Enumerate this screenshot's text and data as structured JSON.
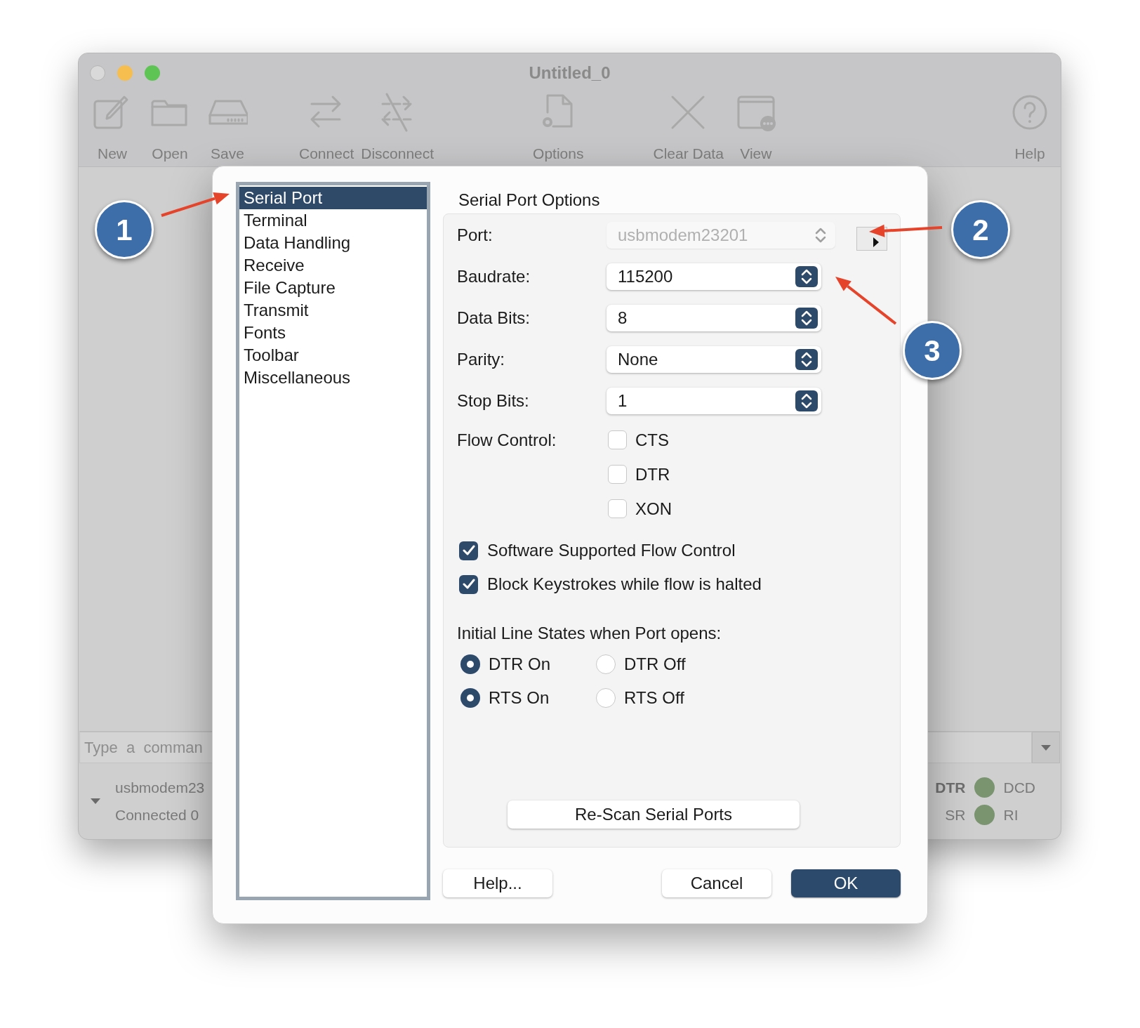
{
  "window": {
    "title": "Untitled_0"
  },
  "toolbar": {
    "groups": [
      [
        "New",
        "Open",
        "Save"
      ],
      [
        "Connect",
        "Disconnect"
      ],
      [
        "Options"
      ],
      [
        "Clear Data",
        "View"
      ]
    ],
    "help": "Help"
  },
  "command_field": {
    "placeholder": "Type  a  comman"
  },
  "status": {
    "port": "usbmodem23",
    "connection": "Connected 0",
    "left_signals": [
      {
        "label": "DTR",
        "active": true
      },
      {
        "label": "SR",
        "active": false
      }
    ],
    "right_signals": [
      "DCD",
      "RI"
    ]
  },
  "dialog": {
    "sidebar": [
      {
        "label": "Serial Port",
        "selected": true
      },
      {
        "label": "Terminal",
        "selected": false
      },
      {
        "label": "Data Handling",
        "selected": false
      },
      {
        "label": "Receive",
        "selected": false
      },
      {
        "label": "File Capture",
        "selected": false
      },
      {
        "label": "Transmit",
        "selected": false
      },
      {
        "label": "Fonts",
        "selected": false
      },
      {
        "label": "Toolbar",
        "selected": false
      },
      {
        "label": "Miscellaneous",
        "selected": false
      }
    ],
    "title": "Serial Port Options",
    "fields": [
      {
        "label": "Port:",
        "value": "usbmodem23201",
        "kind": "port",
        "disabled": true
      },
      {
        "label": "Baudrate:",
        "value": "115200",
        "kind": "popup",
        "disabled": false
      },
      {
        "label": "Data Bits:",
        "value": "8",
        "kind": "popup",
        "disabled": false
      },
      {
        "label": "Parity:",
        "value": "None",
        "kind": "popup",
        "disabled": false
      },
      {
        "label": "Stop Bits:",
        "value": "1",
        "kind": "popup",
        "disabled": false
      }
    ],
    "flow_control": {
      "label": "Flow Control:",
      "options": [
        {
          "label": "CTS",
          "checked": false
        },
        {
          "label": "DTR",
          "checked": false
        },
        {
          "label": "XON",
          "checked": false
        }
      ]
    },
    "checks": [
      {
        "label": "Software Supported Flow Control",
        "checked": true
      },
      {
        "label": "Block Keystrokes while flow is halted",
        "checked": true
      }
    ],
    "line_states": {
      "title": "Initial Line States when Port opens:",
      "rows": [
        [
          {
            "label": "DTR On",
            "selected": true
          },
          {
            "label": "DTR Off",
            "selected": false
          }
        ],
        [
          {
            "label": "RTS On",
            "selected": true
          },
          {
            "label": "RTS Off",
            "selected": false
          }
        ]
      ]
    },
    "rescan": "Re-Scan Serial Ports",
    "buttons": [
      {
        "label": "Help...",
        "kind": "plain"
      },
      {
        "label": "Cancel",
        "kind": "plain"
      },
      {
        "label": "OK",
        "kind": "default"
      }
    ]
  },
  "callouts": [
    "1",
    "2",
    "3"
  ]
}
